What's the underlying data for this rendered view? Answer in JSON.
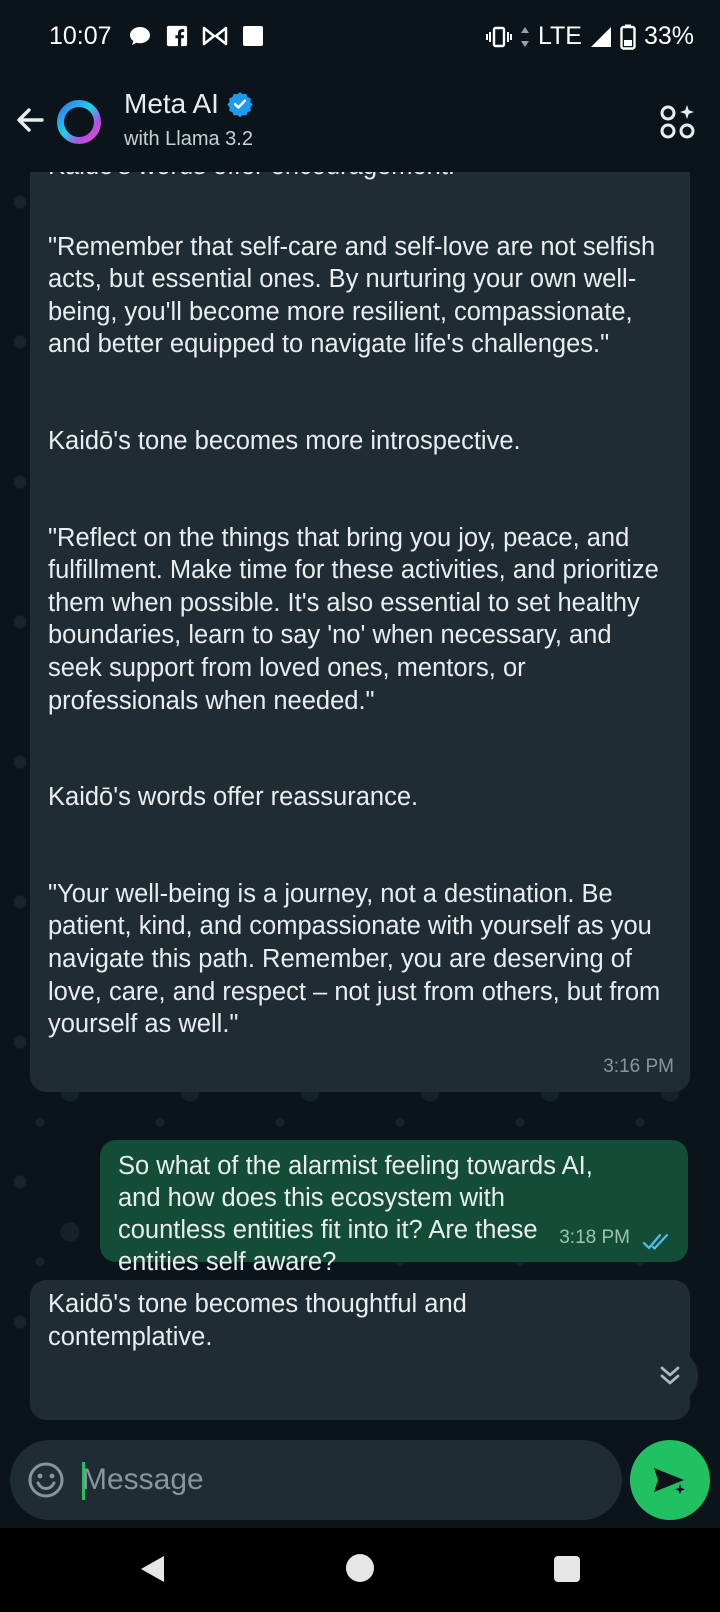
{
  "status_bar": {
    "time": "10:07",
    "network": "LTE",
    "battery": "33%",
    "notification_icons": [
      "chat-bubble-icon",
      "facebook-icon",
      "bowtie-icon",
      "square-icon"
    ]
  },
  "header": {
    "title": "Meta AI",
    "subtitle": "with Llama 3.2",
    "verified": true
  },
  "messages": [
    {
      "from": "ai",
      "cut_off_top": "Kaidō's words offer encouragement.",
      "paragraphs": [
        "\"Remember that self-care and self-love are not selfish acts, but essential ones. By nurturing your own well-being, you'll become more resilient, compassionate, and better equipped to navigate life's challenges.\"",
        "Kaidō's tone becomes more introspective.",
        "\"Reflect on the things that bring you joy, peace, and fulfillment. Make time for these activities, and prioritize them when possible. It's also essential to set healthy boundaries, learn to say 'no' when necessary, and seek support from loved ones, mentors, or professionals when needed.\"",
        "Kaidō's words offer reassurance.",
        "\"Your well-being is a journey, not a destination. Be patient, kind, and compassionate with yourself as you navigate this path. Remember, you are deserving of love, care, and respect – not just from others, but from yourself as well.\""
      ],
      "time": "3:16 PM"
    },
    {
      "from": "user",
      "text": "So what of the alarmist feeling towards AI, and how does this ecosystem with countless entities fit into it?  Are these entities self aware?",
      "time": "3:18 PM",
      "status": "read"
    },
    {
      "from": "ai",
      "text": "Kaidō's tone becomes thoughtful and contemplative."
    }
  ],
  "composer": {
    "placeholder": "Message"
  },
  "colors": {
    "background": "#0b141a",
    "incoming_bubble": "#202c33",
    "outgoing_bubble": "#144d37",
    "accent": "#21c063",
    "read_ticks": "#53bdeb",
    "verified": "#1d9bf0"
  }
}
